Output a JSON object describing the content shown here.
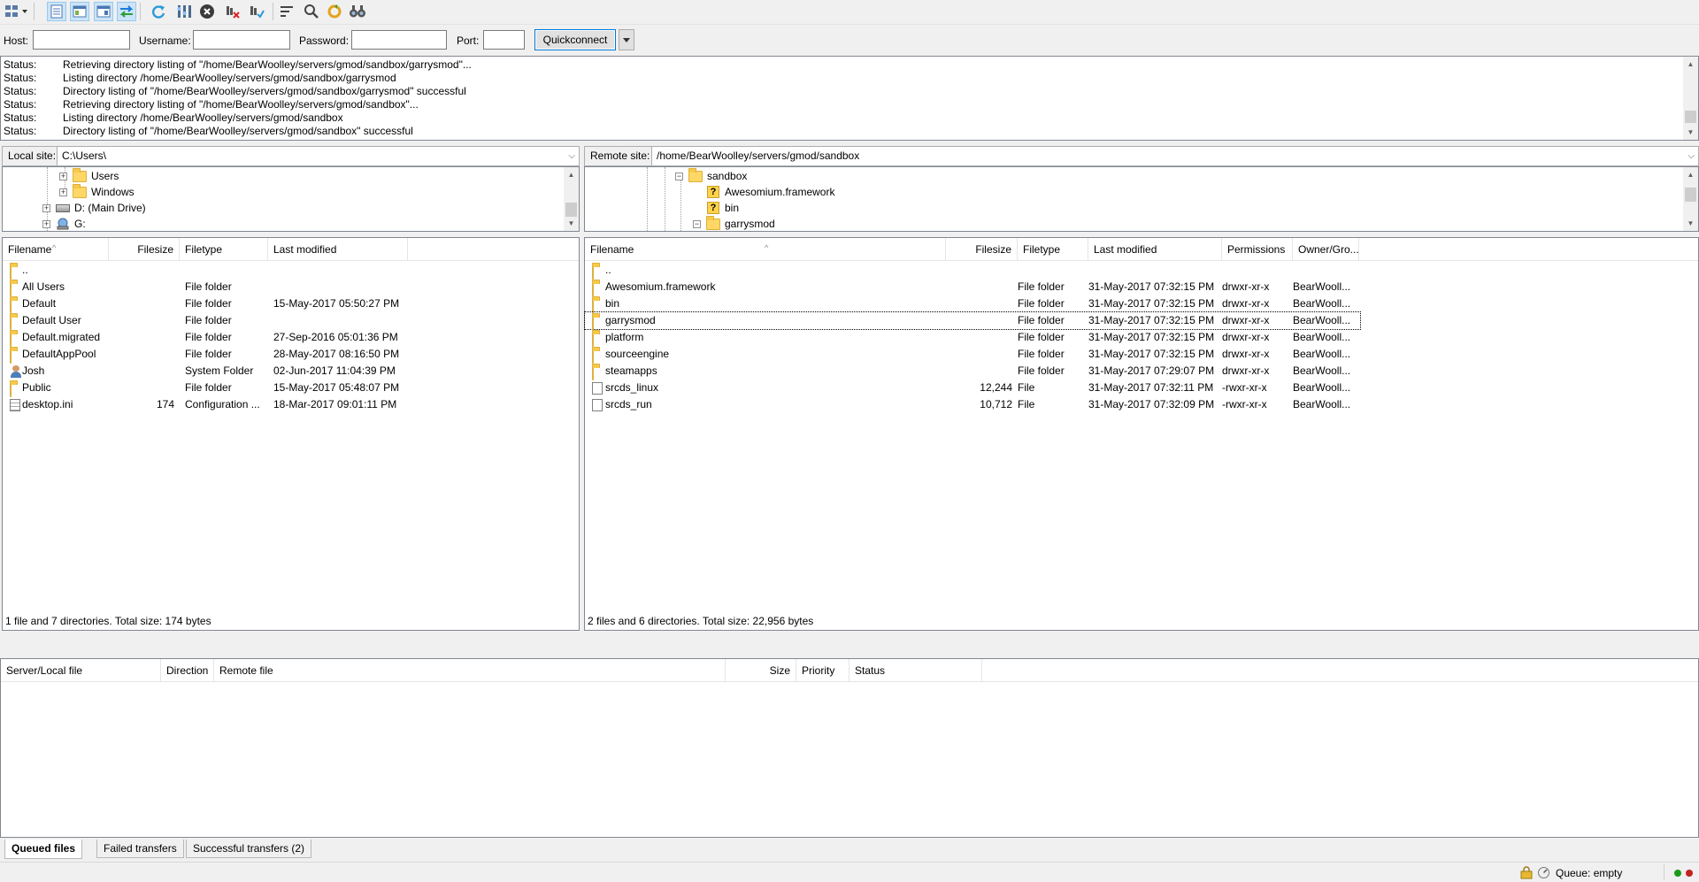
{
  "toolbar": {
    "buttons": [
      {
        "icon": "site-manager-icon"
      },
      {
        "icon": "toggle-message-log-icon"
      },
      {
        "icon": "toggle-local-tree-icon"
      },
      {
        "icon": "toggle-remote-tree-icon"
      },
      {
        "icon": "toggle-transfer-queue-icon"
      },
      {
        "icon": "refresh-icon"
      },
      {
        "icon": "process-queue-icon"
      },
      {
        "icon": "cancel-operation-icon"
      },
      {
        "icon": "disconnect-icon"
      },
      {
        "icon": "reconnect-icon"
      },
      {
        "icon": "directory-filter-icon"
      },
      {
        "icon": "directory-compare-icon"
      },
      {
        "icon": "sync-browsing-icon"
      },
      {
        "icon": "search-files-icon"
      }
    ]
  },
  "quickconnect": {
    "host_label": "Host:",
    "host_value": "",
    "username_label": "Username:",
    "username_value": "",
    "password_label": "Password:",
    "password_value": "",
    "port_label": "Port:",
    "port_value": "",
    "button_label": "Quickconnect"
  },
  "log": [
    {
      "key": "Status:",
      "msg": "Retrieving directory listing of \"/home/BearWoolley/servers/gmod/sandbox/garrysmod\"..."
    },
    {
      "key": "Status:",
      "msg": "Listing directory /home/BearWoolley/servers/gmod/sandbox/garrysmod"
    },
    {
      "key": "Status:",
      "msg": "Directory listing of \"/home/BearWoolley/servers/gmod/sandbox/garrysmod\" successful"
    },
    {
      "key": "Status:",
      "msg": "Retrieving directory listing of \"/home/BearWoolley/servers/gmod/sandbox\"..."
    },
    {
      "key": "Status:",
      "msg": "Listing directory /home/BearWoolley/servers/gmod/sandbox"
    },
    {
      "key": "Status:",
      "msg": "Directory listing of \"/home/BearWoolley/servers/gmod/sandbox\" successful"
    }
  ],
  "local": {
    "site_label": "Local site:",
    "path": "C:\\Users\\",
    "tree": [
      {
        "label": "Users",
        "type": "folder"
      },
      {
        "label": "Windows",
        "type": "folder"
      },
      {
        "label": "D: (Main Drive)",
        "type": "drive"
      },
      {
        "label": "G:",
        "type": "netdrive"
      }
    ],
    "columns": [
      "Filename",
      "Filesize",
      "Filetype",
      "Last modified"
    ],
    "files": [
      {
        "name": "..",
        "size": "",
        "type": "",
        "modified": "",
        "icon": "folder"
      },
      {
        "name": "All Users",
        "size": "",
        "type": "File folder",
        "modified": "",
        "icon": "folder"
      },
      {
        "name": "Default",
        "size": "",
        "type": "File folder",
        "modified": "15-May-2017 05:50:27 PM",
        "icon": "folder"
      },
      {
        "name": "Default User",
        "size": "",
        "type": "File folder",
        "modified": "",
        "icon": "folder"
      },
      {
        "name": "Default.migrated",
        "size": "",
        "type": "File folder",
        "modified": "27-Sep-2016 05:01:36 PM",
        "icon": "folder"
      },
      {
        "name": "DefaultAppPool",
        "size": "",
        "type": "File folder",
        "modified": "28-May-2017 08:16:50 PM",
        "icon": "folder"
      },
      {
        "name": "Josh",
        "size": "",
        "type": "System Folder",
        "modified": "02-Jun-2017 11:04:39 PM",
        "icon": "user"
      },
      {
        "name": "Public",
        "size": "",
        "type": "File folder",
        "modified": "15-May-2017 05:48:07 PM",
        "icon": "folder"
      },
      {
        "name": "desktop.ini",
        "size": "174",
        "type": "Configuration ...",
        "modified": "18-Mar-2017 09:01:11 PM",
        "icon": "ini"
      }
    ],
    "status": "1 file and 7 directories. Total size: 174 bytes"
  },
  "remote": {
    "site_label": "Remote site:",
    "path": "/home/BearWoolley/servers/gmod/sandbox",
    "tree": [
      {
        "label": "sandbox",
        "type": "folder"
      },
      {
        "label": "Awesomium.framework",
        "type": "unknown"
      },
      {
        "label": "bin",
        "type": "unknown"
      },
      {
        "label": "garrysmod",
        "type": "folder"
      }
    ],
    "columns": [
      "Filename",
      "Filesize",
      "Filetype",
      "Last modified",
      "Permissions",
      "Owner/Gro..."
    ],
    "files": [
      {
        "name": "..",
        "size": "",
        "type": "",
        "modified": "",
        "perm": "",
        "owner": "",
        "icon": "folder"
      },
      {
        "name": "Awesomium.framework",
        "size": "",
        "type": "File folder",
        "modified": "31-May-2017 07:32:15 PM",
        "perm": "drwxr-xr-x",
        "owner": "BearWooll...",
        "icon": "folder"
      },
      {
        "name": "bin",
        "size": "",
        "type": "File folder",
        "modified": "31-May-2017 07:32:15 PM",
        "perm": "drwxr-xr-x",
        "owner": "BearWooll...",
        "icon": "folder"
      },
      {
        "name": "garrysmod",
        "size": "",
        "type": "File folder",
        "modified": "31-May-2017 07:32:15 PM",
        "perm": "drwxr-xr-x",
        "owner": "BearWooll...",
        "icon": "folder"
      },
      {
        "name": "platform",
        "size": "",
        "type": "File folder",
        "modified": "31-May-2017 07:32:15 PM",
        "perm": "drwxr-xr-x",
        "owner": "BearWooll...",
        "icon": "folder"
      },
      {
        "name": "sourceengine",
        "size": "",
        "type": "File folder",
        "modified": "31-May-2017 07:32:15 PM",
        "perm": "drwxr-xr-x",
        "owner": "BearWooll...",
        "icon": "folder"
      },
      {
        "name": "steamapps",
        "size": "",
        "type": "File folder",
        "modified": "31-May-2017 07:29:07 PM",
        "perm": "drwxr-xr-x",
        "owner": "BearWooll...",
        "icon": "folder"
      },
      {
        "name": "srcds_linux",
        "size": "12,244",
        "type": "File",
        "modified": "31-May-2017 07:32:11 PM",
        "perm": "-rwxr-xr-x",
        "owner": "BearWooll...",
        "icon": "file"
      },
      {
        "name": "srcds_run",
        "size": "10,712",
        "type": "File",
        "modified": "31-May-2017 07:32:09 PM",
        "perm": "-rwxr-xr-x",
        "owner": "BearWooll...",
        "icon": "file"
      }
    ],
    "status": "2 files and 6 directories. Total size: 22,956 bytes"
  },
  "queue": {
    "columns": [
      "Server/Local file",
      "Direction",
      "Remote file",
      "Size",
      "Priority",
      "Status"
    ],
    "tabs": [
      {
        "label": "Queued files",
        "active": true
      },
      {
        "label": "Failed transfers",
        "active": false
      },
      {
        "label": "Successful transfers (2)",
        "active": false
      }
    ]
  },
  "statusbar": {
    "queue_text": "Queue: empty"
  },
  "colors": {
    "accent": "#0078d7",
    "folder": "#ffd766",
    "led_green": "#1a9a1a",
    "led_red": "#c42020"
  }
}
